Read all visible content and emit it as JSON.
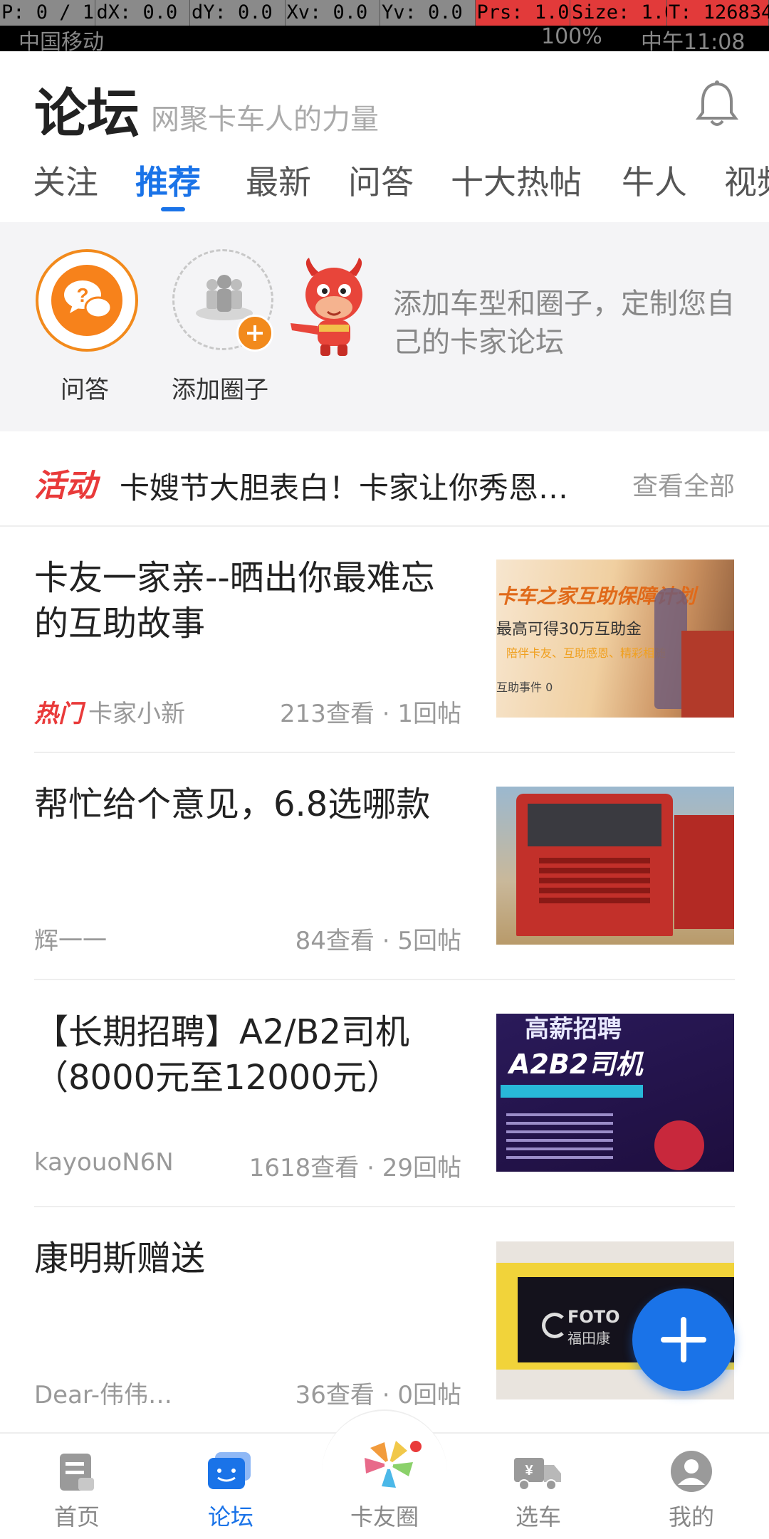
{
  "debug_bar": {
    "items": [
      "P: 0 / 1",
      "dX: 0.0",
      "dY: 0.0",
      "Xv: 0.0",
      "Yv: 0.0",
      "Prs: 1.0",
      "Size: 1.0",
      "T: 126834"
    ]
  },
  "status_bar": {
    "carrier": "中国移动",
    "battery": "100%",
    "time": "中午11:08"
  },
  "header": {
    "title": "论坛",
    "subtitle": "网聚卡车人的力量"
  },
  "tabs": [
    {
      "label": "关注",
      "active": false
    },
    {
      "label": "推荐",
      "active": true
    },
    {
      "label": "最新",
      "active": false
    },
    {
      "label": "问答",
      "active": false
    },
    {
      "label": "十大热帖",
      "active": false
    },
    {
      "label": "牛人",
      "active": false
    },
    {
      "label": "视频",
      "active": false
    }
  ],
  "shortcuts": {
    "items": [
      {
        "label": "问答",
        "icon": "qa-bubble-icon"
      },
      {
        "label": "添加圈子",
        "icon": "add-group-icon"
      }
    ],
    "promo_text": "添加车型和圈子，定制您自己的卡家论坛"
  },
  "activity": {
    "tag": "活动",
    "text": "卡嫂节大胆表白！卡家让你秀恩爱…",
    "view_all": "查看全部"
  },
  "posts": [
    {
      "title": "卡友一家亲--晒出你最难忘的互助故事",
      "tag": "热门",
      "author": "卡家小新",
      "stats": "213查看 · 1回帖",
      "thumb_lines": [
        "卡车之家互助保障计划",
        "最高可得30万互助金",
        "陪伴卡友、互助感恩、精彩相随",
        "互助事件 0"
      ]
    },
    {
      "title": "帮忙给个意见，6.8选哪款",
      "tag": "",
      "author": "辉一一",
      "stats": "84查看 · 5回帖",
      "thumb_lines": []
    },
    {
      "title": "【长期招聘】A2/B2司机（8000元至12000元）",
      "tag": "",
      "author": "kayouoN6N",
      "stats": "1618查看 · 29回帖",
      "thumb_lines": [
        "高薪招聘",
        "A2B2司机"
      ]
    },
    {
      "title": "康明斯赠送",
      "tag": "",
      "author": "Dear-伟伟…",
      "stats": "36查看 · 0回帖",
      "thumb_lines": [
        "FOTO",
        "福田康"
      ]
    }
  ],
  "bottom_nav": [
    {
      "label": "首页",
      "icon": "home-doc-icon",
      "active": false
    },
    {
      "label": "论坛",
      "icon": "forum-chat-icon",
      "active": true
    },
    {
      "label": "卡友圈",
      "icon": "pinwheel-icon",
      "active": false
    },
    {
      "label": "选车",
      "icon": "truck-icon",
      "active": false
    },
    {
      "label": "我的",
      "icon": "profile-icon",
      "active": false
    }
  ],
  "colors": {
    "accent": "#1a73e8",
    "hot_red": "#e93a3a",
    "orange": "#f7821b"
  }
}
